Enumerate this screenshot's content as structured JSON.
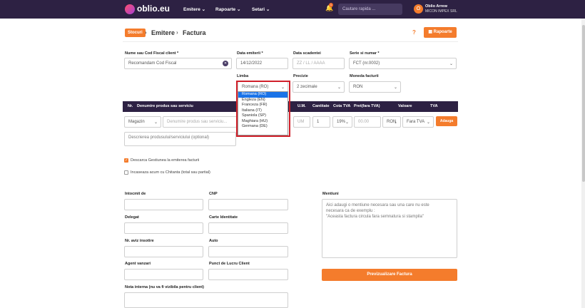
{
  "header": {
    "logo_text": "oblio.eu",
    "nav": [
      "Emitere",
      "Rapoarte",
      "Setari"
    ],
    "notification_count": "1",
    "search_placeholder": "Cautare rapida ...",
    "user_initial": "O",
    "user_name": "Oblio Arrew",
    "user_company": "MICON IMPEX SRL"
  },
  "breadcrumb": {
    "stocuri": "Stocuri",
    "emitere": "Emitere",
    "factura": "Factura"
  },
  "toolbar": {
    "help": "?",
    "rapoarte": "Rapoarte"
  },
  "form": {
    "client_label": "Nume sau Cod Fiscal client *",
    "client_value": "Recomandam Cod Fiscal",
    "date_emit_label": "Data emiterii *",
    "date_emit_value": "14/12/2022",
    "due_label": "Data scadentei",
    "due_placeholder": "ZZ / LL / AAAA",
    "series_label": "Serie si numar *",
    "series_value": "FCT (nr.0002)",
    "language_label": "Limba",
    "language_value": "Romana (RO)",
    "precision_label": "Precizie",
    "precision_value": "2 zecimale",
    "currency_label": "Moneda facturii",
    "currency_value": "RON"
  },
  "language_options": [
    "Romana (RO)",
    "Engleza (EN)",
    "Franceza (FR)",
    "Italiana (IT)",
    "Spaniola (SP)",
    "Maghiara (HU)",
    "Germana (DE)"
  ],
  "table": {
    "headers": [
      "Nr.",
      "Denumire produs sau serviciu",
      "U.M.",
      "Cantitate",
      "Cota TVA",
      "Pret(fara TVA)",
      "Valoare",
      "TVA"
    ],
    "row": {
      "gestiune": "Magazin",
      "product_placeholder": "Denumire produs sau serviciu...",
      "um_placeholder": "UM",
      "qty": "1",
      "vat": "19%",
      "price": "00.00",
      "currency": "RON",
      "vat_type": "Fara TVA",
      "add_button": "Adauga"
    },
    "description_placeholder": "Descrierea produsului/serviciului (optional)"
  },
  "options": {
    "descarca_label": "Descarca Gestiunea la emiterea facturii",
    "incaseaza_label": "Incaseaza acum cu Chitanta (total sau partial)"
  },
  "details": {
    "intocmit": "Intocmit de",
    "cnp": "CNP",
    "delegat": "Delegat",
    "carte": "Carte Identitate",
    "aviz": "Nr. aviz insotire",
    "auto": "Auto",
    "agent": "Agent vanzari",
    "punct": "Punct de Lucru Client",
    "nota": "Nota interna (nu va fi vizibila pentru client)",
    "mentiuni": "Mentiuni",
    "mentiuni_placeholder_1": "Aici adaugi o mentiune necesara sau una care nu este",
    "mentiuni_placeholder_2": "necesara ca de exemplu :",
    "mentiuni_placeholder_3": "\"Aceasta factura circula fara semnatura si stampila\""
  },
  "preview_button": "Previzualizare Factura",
  "colors": {
    "topbar": "#2d2143",
    "accent": "#f47c2c",
    "highlight": "#d0202a",
    "selected_option": "#1a73e8"
  }
}
